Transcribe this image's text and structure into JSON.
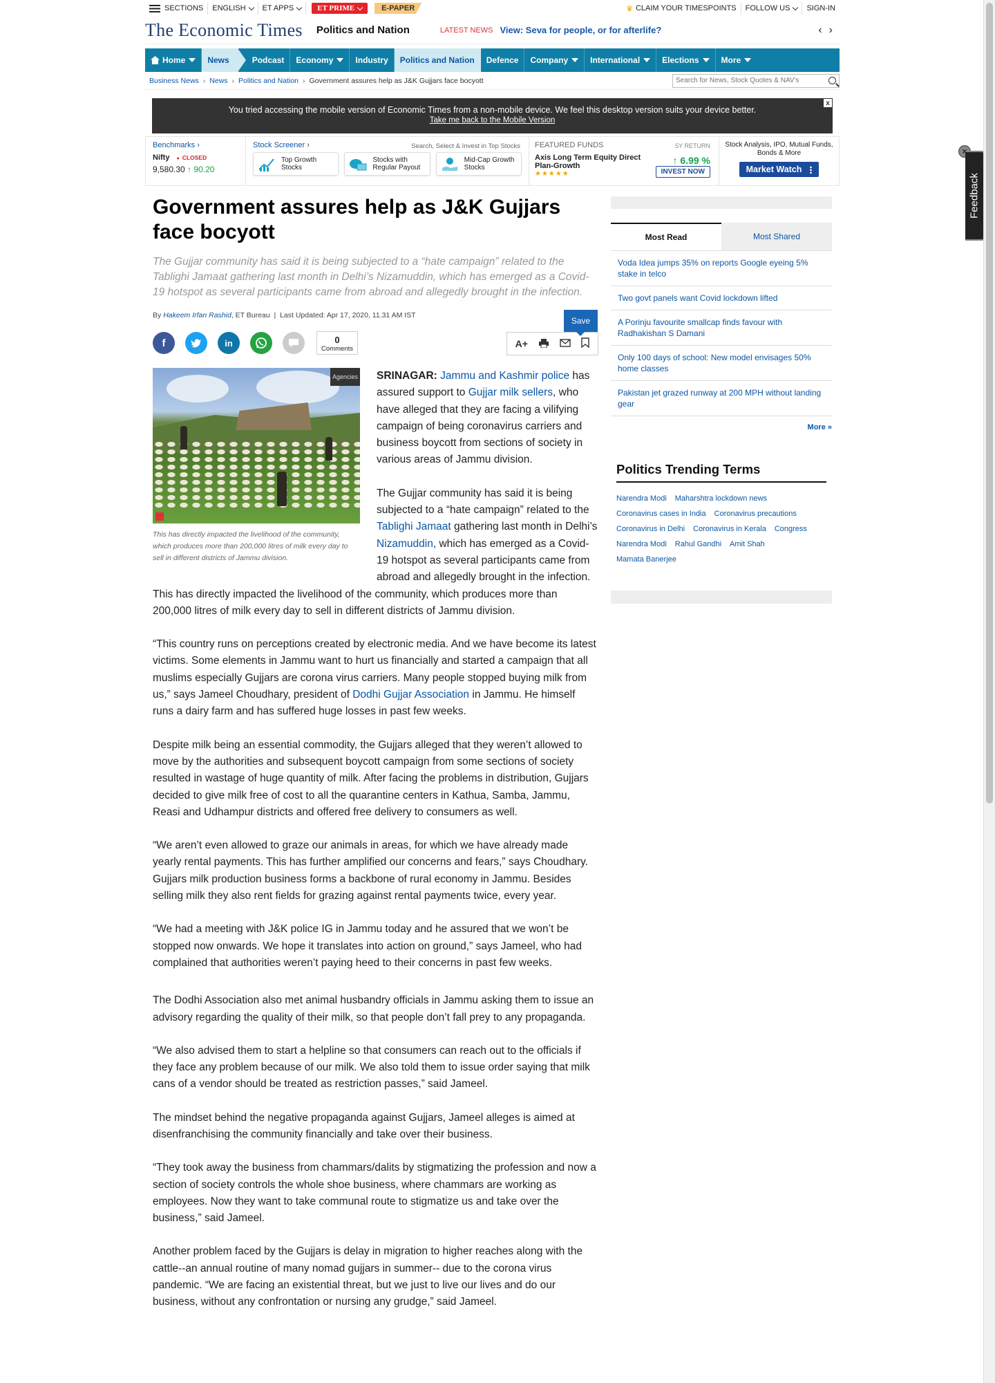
{
  "topbar": {
    "sections": "SECTIONS",
    "language": "ENGLISH",
    "etapps": "ET APPS",
    "etprime": "ET PRIME",
    "epaper": "E-PAPER",
    "timespoints": "CLAIM YOUR TIMESPOINTS",
    "follow": "FOLLOW US",
    "signin": "SIGN-IN"
  },
  "masthead": {
    "logo": "The Economic Times",
    "section": "Politics and Nation",
    "latest_label": "LATEST NEWS",
    "latest_link": "View: Seva for people, or for afterlife?"
  },
  "nav": {
    "items": [
      "Home",
      "News",
      "Podcast",
      "Economy",
      "Industry",
      "Politics and Nation",
      "Defence",
      "Company",
      "International",
      "Elections",
      "More"
    ]
  },
  "breadcrumb": {
    "items": [
      "Business News",
      "News",
      "Politics and Nation"
    ],
    "current": "Government assures help as J&K Gujjars face bocyott",
    "search_placeholder": "Search for News, Stock Quotes & NAV's"
  },
  "notice": {
    "text": "You tried accessing the mobile version of Economic Times from a non-mobile device. We feel this desktop version suits your device better.",
    "link": "Take me back to the Mobile Version",
    "close": "x"
  },
  "market": {
    "benchmarks": "Benchmarks",
    "index": "Nifty",
    "status": "CLOSED",
    "value": "9,580.30",
    "change": "90.20",
    "screener": "Stock Screener",
    "screener_sub": "Search, Select & Invest in Top Stocks",
    "cards": [
      "Top Growth Stocks",
      "Stocks with Regular Payout",
      "Mid-Cap Growth Stocks"
    ],
    "ff_label": "FEATURED FUNDS",
    "ff_period": "5Y RETURN",
    "ff_name": "Axis Long Term Equity Direct Plan-Growth",
    "ff_return": "6.99 %",
    "ff_stars": "★★★★★",
    "ff_invest": "INVEST NOW",
    "mw_text": "Stock Analysis, IPO, Mutual Funds, Bonds & More",
    "mw_button": "Market Watch"
  },
  "article": {
    "title": "Government assures help as J&K Gujjars face bocyott",
    "synopsis": "The Gujjar community has said it is being subjected to a “hate campaign” related to the Tablighi Jamaat gathering last month in Delhi’s Nizamuddin, which has emerged as a Covid-19 hotspot as several participants came from abroad and allegedly brought in the infection.",
    "by": "By",
    "author": "Hakeem Irfan Rashid",
    "bureau": ", ET Bureau",
    "updated": "Last Updated: Apr 17, 2020, 11.31 AM IST",
    "comments_count": "0",
    "comments_label": "Comments",
    "save": "Save",
    "image_tag": "Agencies",
    "caption": "This has directly impacted the livelihood of the community, which produces more than 200,000 litres of milk every day to sell in different districts of Jammu division.",
    "p1_dateline": "SRINAGAR:",
    "p1_link1": "Jammu and Kashmir police",
    "p1_a": " has assured support to ",
    "p1_link2": "Gujjar milk sellers",
    "p1_b": ", who have alleged that they are facing a vilifying campaign of being coronavirus carriers and business boycott from sections of society in various areas of Jammu division.",
    "p2_a": "The Gujjar community has said it is being subjected to a “hate campaign” related to the ",
    "p2_link1": "Tablighi Jamaat",
    "p2_b": " gathering last month in Delhi’s ",
    "p2_link2": "Nizamuddin",
    "p2_c": ", which has emerged as a Covid-19 hotspot as several participants came from abroad and allegedly brought in the infection. This has directly impacted the livelihood of the community, which produces more than 200,000 litres of milk every day to sell in different districts of Jammu division.",
    "p3_a": "“This country runs on perceptions created by electronic media. And we have become its latest victims. Some elements in Jammu want to hurt us financially and started a campaign that all muslims especially Gujjars are corona virus carriers. Many people stopped buying milk from us,” says Jameel Choudhary, president of ",
    "p3_link": "Dodhi Gujjar Association",
    "p3_b": " in Jammu. He himself runs a dairy farm and has suffered huge losses in past few weeks.",
    "p4": "Despite milk being an essential commodity, the Gujjars alleged that they weren’t allowed to move by the authorities and subsequent boycott campaign from some sections of society resulted in wastage of huge quantity of milk. After facing the problems in distribution, Gujjars decided to give milk free of cost to all the quarantine centers in Kathua, Samba, Jammu, Reasi and Udhampur districts and offered free delivery to consumers as well.",
    "p5": "“We aren’t even allowed to graze our animals in areas, for which we have already made yearly rental payments. This has further amplified our concerns and fears,” says Choudhary. Gujjars milk production business forms a backbone of rural economy in Jammu. Besides selling milk they also rent fields for grazing against rental payments twice, every year.",
    "p6": "“We had a meeting with J&K police IG in Jammu today and he assured that we won’t be stopped now onwards. We hope it translates into action on ground,” says Jameel, who had complained that authorities weren’t paying heed to their concerns in past few weeks.",
    "p7": "The Dodhi Association also met animal husbandry officials in Jammu asking them to issue an advisory regarding the quality of their milk, so that people don’t fall prey to any propaganda.",
    "p8": "“We also advised them to start a helpline so that consumers can reach out to the officials if they face any problem because of our milk. We also told them to issue order saying that milk cans of a vendor should be treated as restriction passes,” said Jameel.",
    "p9": "The mindset behind the negative propaganda against Gujjars, Jameel alleges is aimed at disenfranchising the community financially and take over their business.",
    "p10": "“They took away the business from chammars/dalits by stigmatizing the profession and now a section of society controls the whole shoe business, where chammars are working as employees. Now they want to take communal route to stigmatize us and take over the business,” said Jameel.",
    "p11": "Another problem faced by the Gujjars is delay in migration to higher reaches along with the cattle--an annual routine of many nomad gujjars in summer-- due to the corona virus pandemic. “We are facing an existential threat, but we just to live our lives and do our business, without any confrontation or nursing any grudge,” said Jameel."
  },
  "rail": {
    "tabs": [
      "Most Read",
      "Most Shared"
    ],
    "most_read": [
      "Voda Idea jumps 35% on reports Google eyeing 5% stake in telco",
      "Two govt panels want Covid lockdown lifted",
      "A Porinju favourite smallcap finds favour with Radhakishan S Damani",
      "Only 100 days of school: New model envisages 50% home classes",
      "Pakistan jet grazed runway at 200 MPH without landing gear"
    ],
    "more": "More »",
    "trend_title": "Politics Trending Terms",
    "terms": [
      "Narendra Modi",
      "Maharshtra lockdown news",
      "Coronavirus cases in India",
      "Coronavirus precautions",
      "Coronavirus in Delhi",
      "Coronavirus in Kerala",
      "Congress",
      "Narendra Modi",
      "Rahul Gandhi",
      "Amit Shah",
      "Mamata Banerjee"
    ]
  },
  "feedback": {
    "label": "Feedback",
    "close": "×"
  },
  "colors": {
    "nav": "#0f7fa7",
    "link": "#0b56a4",
    "accent_red": "#e4232a"
  }
}
